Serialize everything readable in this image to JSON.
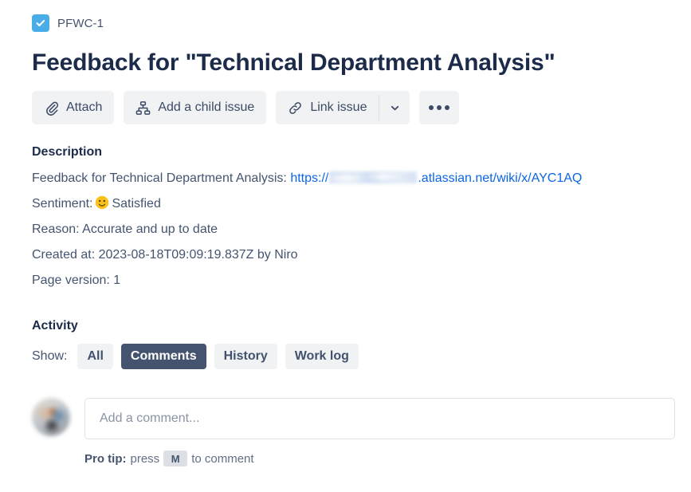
{
  "breadcrumb": {
    "issue_type_icon": "task-checkbox-icon",
    "issue_key": "PFWC-1",
    "icon_color": "#4bade8"
  },
  "header": {
    "title": "Feedback for \"Technical Department Analysis\"",
    "title_color": "#1d2b4b"
  },
  "toolbar": {
    "attach_label": "Attach",
    "attach_icon": "paperclip-icon",
    "child_issue_label": "Add a child issue",
    "child_issue_icon": "hierarchy-icon",
    "link_issue_label": "Link issue",
    "link_issue_icon": "chain-link-icon",
    "dropdown_icon": "chevron-down-icon",
    "more_icon": "ellipsis-icon",
    "button_bg": "#f1f2f4"
  },
  "description": {
    "heading": "Description",
    "feedback_prefix": "Feedback for Technical Department Analysis: ",
    "url_scheme": "https://",
    "url_redacted": "",
    "url_suffix": ".atlassian.net/wiki/x/AYC1AQ",
    "link_color": "#0c66e4",
    "sentiment_label": "Sentiment:",
    "sentiment_emoji": "slightly-smiling-face",
    "sentiment_value": "Satisfied",
    "reason_line": "Reason: Accurate and up to date",
    "created_line": "Created at: 2023-08-18T09:09:19.837Z by Niro",
    "page_version_line": "Page version: 1"
  },
  "activity": {
    "heading": "Activity",
    "show_label": "Show:",
    "filters": [
      {
        "label": "All",
        "selected": false
      },
      {
        "label": "Comments",
        "selected": true
      },
      {
        "label": "History",
        "selected": false
      },
      {
        "label": "Work log",
        "selected": false
      }
    ],
    "selected_bg": "#44546f"
  },
  "comment": {
    "avatar": "user-avatar",
    "placeholder": "Add a comment...",
    "value": "",
    "protip_bold": "Pro tip:",
    "protip_press": "press",
    "protip_key": "M",
    "protip_tail": "to comment"
  }
}
